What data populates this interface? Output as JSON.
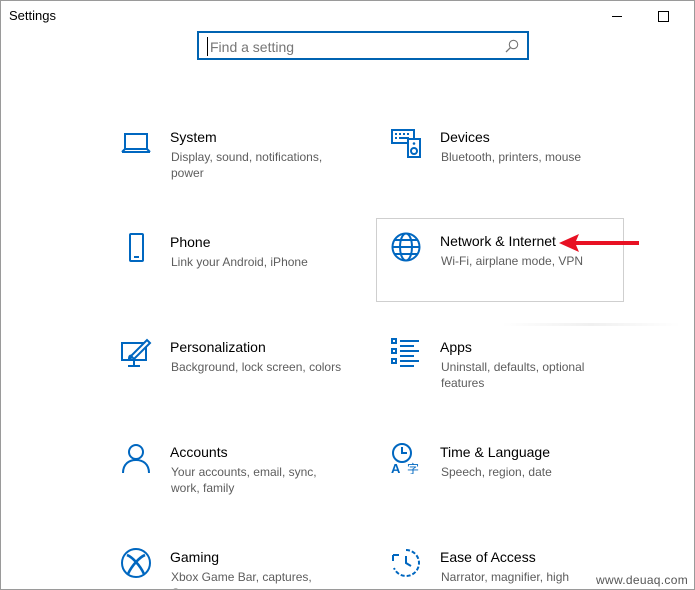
{
  "window": {
    "title": "Settings"
  },
  "search": {
    "placeholder": "Find a setting",
    "value": ""
  },
  "tiles": [
    {
      "name": "System",
      "description": "Display, sound, notifications, power",
      "icon": "laptop-icon"
    },
    {
      "name": "Devices",
      "description": "Bluetooth, printers, mouse",
      "icon": "keyboard-speaker-icon"
    },
    {
      "name": "Phone",
      "description": "Link your Android, iPhone",
      "icon": "phone-icon"
    },
    {
      "name": "Network & Internet",
      "description": "Wi-Fi, airplane mode, VPN",
      "icon": "globe-icon",
      "highlighted": true
    },
    {
      "name": "Personalization",
      "description": "Background, lock screen, colors",
      "icon": "paint-display-icon"
    },
    {
      "name": "Apps",
      "description": "Uninstall, defaults, optional features",
      "icon": "apps-list-icon"
    },
    {
      "name": "Accounts",
      "description": "Your accounts, email, sync, work, family",
      "icon": "person-icon"
    },
    {
      "name": "Time & Language",
      "description": "Speech, region, date",
      "icon": "clock-language-icon"
    },
    {
      "name": "Gaming",
      "description": "Xbox Game Bar, captures, Game",
      "icon": "xbox-icon"
    },
    {
      "name": "Ease of Access",
      "description": "Narrator, magnifier, high",
      "icon": "ease-of-access-icon"
    }
  ],
  "annotation": {
    "arrow_color": "#e81123",
    "points_to": "Network & Internet"
  },
  "colors": {
    "accent": "#0063b1",
    "icon": "#0067c0"
  },
  "watermark": "www.deuaq.com"
}
